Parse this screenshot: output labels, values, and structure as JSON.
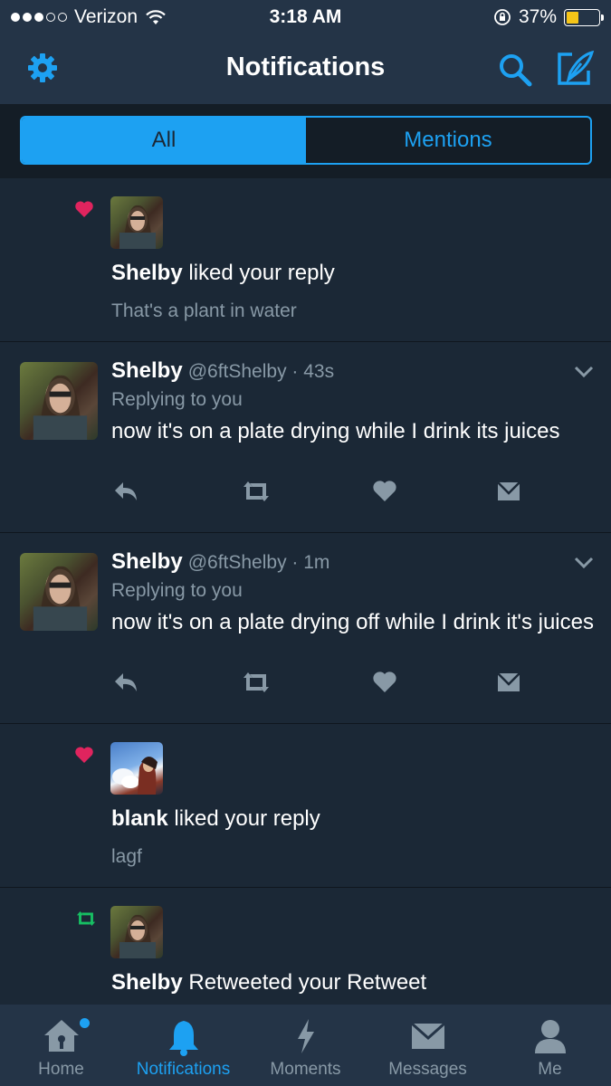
{
  "status_bar": {
    "carrier": "Verizon",
    "time": "3:18 AM",
    "battery_percent": "37%",
    "battery_level": 0.37,
    "signal_bars_filled": 3,
    "signal_bars_total": 5
  },
  "nav": {
    "title": "Notifications",
    "left_icon": "gear-icon",
    "right_icons": [
      "search-icon",
      "compose-icon"
    ]
  },
  "tabs": {
    "all_label": "All",
    "mentions_label": "Mentions",
    "selected": "All"
  },
  "notifications": [
    {
      "type": "like",
      "icon": "heart-icon",
      "user": "Shelby",
      "action": " liked your reply",
      "snippet": "That's a plant in water"
    },
    {
      "type": "tweet",
      "name": "Shelby",
      "handle": "@6ftShelby · 43s",
      "replying": "Replying to you",
      "text": "now it's on a plate drying while I drink its juices"
    },
    {
      "type": "tweet",
      "name": "Shelby",
      "handle": "@6ftShelby · 1m",
      "replying": "Replying to you",
      "text": "now it's on a plate drying off while I drink it's juices"
    },
    {
      "type": "like",
      "icon": "heart-icon",
      "user": "blank",
      "action": " liked your reply",
      "snippet": "lagf"
    },
    {
      "type": "retweet",
      "icon": "retweet-icon",
      "user": "Shelby",
      "action": " Retweeted your Retweet"
    }
  ],
  "tabbar": {
    "items": [
      {
        "label": "Home",
        "icon": "home-icon"
      },
      {
        "label": "Notifications",
        "icon": "bell-icon"
      },
      {
        "label": "Moments",
        "icon": "lightning-icon"
      },
      {
        "label": "Messages",
        "icon": "envelope-icon"
      },
      {
        "label": "Me",
        "icon": "person-icon"
      }
    ],
    "active": "Notifications"
  },
  "colors": {
    "accent": "#1da1f2",
    "background": "#1b2836",
    "bar": "#243447",
    "muted": "#8899a6",
    "like": "#e0245e",
    "retweet": "#17bf63",
    "battery": "#f5c518"
  }
}
